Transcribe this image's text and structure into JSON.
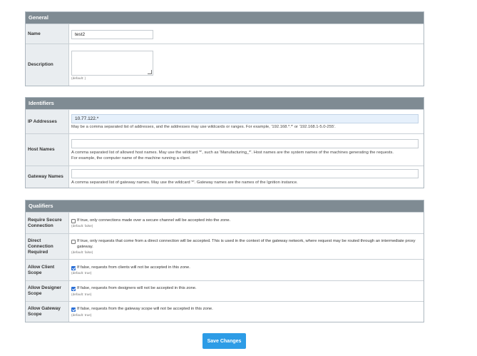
{
  "general": {
    "title": "General",
    "name_label": "Name",
    "name_value": "test2",
    "description_label": "Description",
    "description_value": "",
    "description_default": "(default: )"
  },
  "identifiers": {
    "title": "Identifiers",
    "ip_label": "IP Addresses",
    "ip_value": "10.77.122.*",
    "ip_help": "May be a comma separated list of addresses, and the addresses may use wildcards or ranges. For example, '192.168.*.*' or '192.168.1-5.0-255'.",
    "host_label": "Host Names",
    "host_value": "",
    "host_help_1": "A comma separated list of allowed host names. May use the wildcard '*', such as 'Manufacturing_*'. Host names are the system names of the machines generating the requests.",
    "host_help_2": "For example, the computer name of the machine running a client.",
    "gateway_label": "Gateway Names",
    "gateway_value": "",
    "gateway_help": "A comma separated list of gateway names. May use the wildcard '*'. Gateway names are the names of the Ignition instance."
  },
  "qualifiers": {
    "title": "Qualifiers",
    "secure_label": "Require Secure Connection",
    "secure_checked": false,
    "secure_text": "If true, only connections made over a secure channel will be accepted into the zone.",
    "secure_default": "(default: false)",
    "direct_label": "Direct Connection Required",
    "direct_checked": false,
    "direct_text": "If true, only requests that come from a direct connection will be accepted. This is used in the context of the gateway network, where request may be routed through an intermediate proxy gateway.",
    "direct_default": "(default: false)",
    "client_label": "Allow Client Scope",
    "client_checked": true,
    "client_text": "If false, requests from clients will not be accepted in this zone.",
    "client_default": "(default: true)",
    "designer_label": "Allow Designer Scope",
    "designer_checked": true,
    "designer_text": "If false, requests from designers will not be accepted in this zone.",
    "designer_default": "(default: true)",
    "gwscope_label": "Allow Gateway Scope",
    "gwscope_checked": true,
    "gwscope_text": "If false, requests from the gateway scope will not be accepted in this zone.",
    "gwscope_default": "(default: true)"
  },
  "save_label": "Save Changes"
}
